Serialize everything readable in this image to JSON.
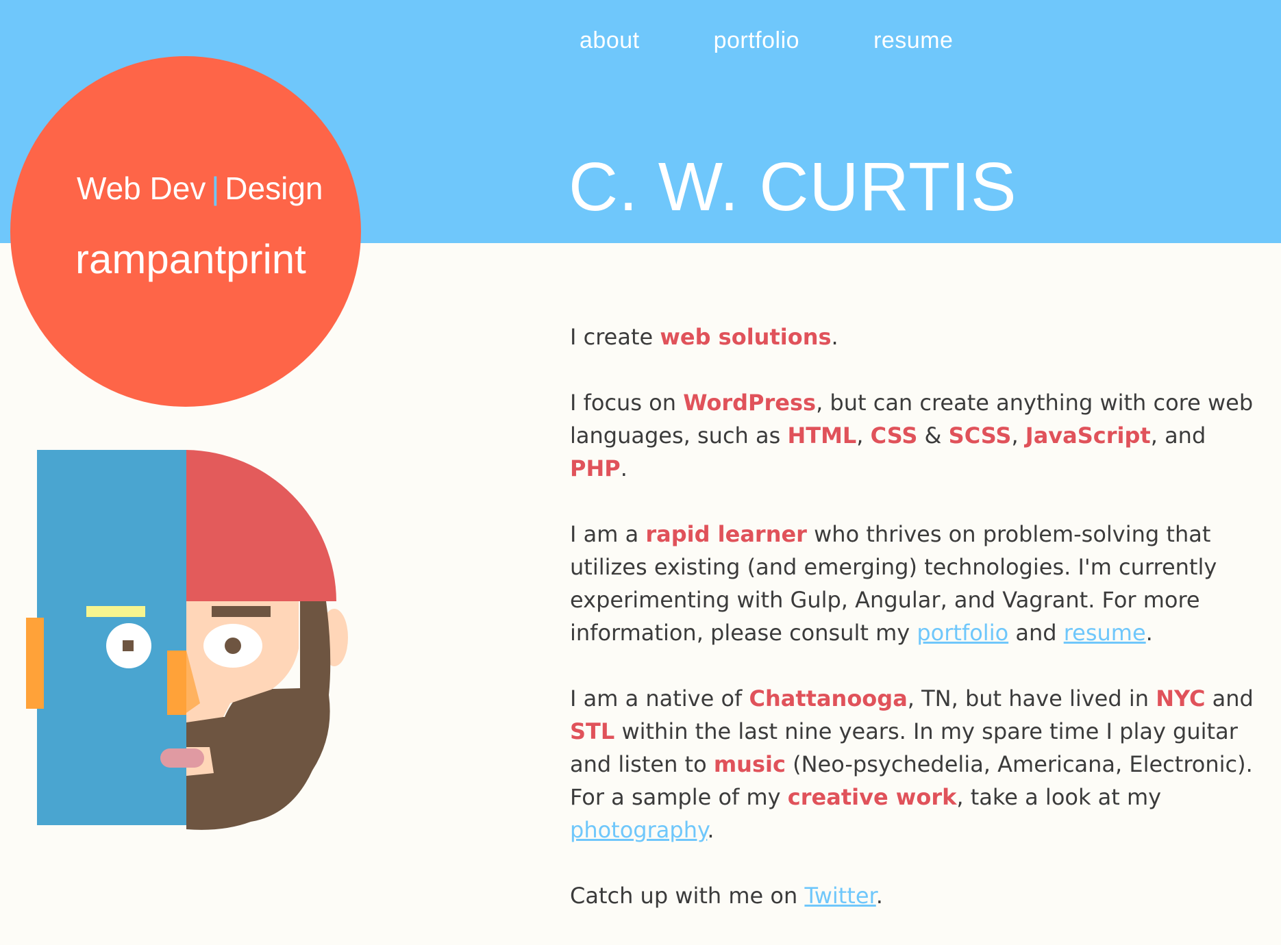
{
  "nav": {
    "items": [
      {
        "label": "about"
      },
      {
        "label": "portfolio"
      },
      {
        "label": "resume"
      }
    ]
  },
  "header": {
    "title": "C. W. CURTIS"
  },
  "badge": {
    "tagline_left": "Web Dev",
    "tagline_separator": "|",
    "tagline_right": "Design",
    "brand": "rampantprint"
  },
  "colors": {
    "header_bg": "#6fc7fb",
    "badge_bg": "#fe6548",
    "highlight": "#e0525a",
    "link": "#6fc7fb",
    "page_bg": "#fdfcf7"
  },
  "content": {
    "p1": {
      "t1": "I create ",
      "h1": "web solutions",
      "t2": "."
    },
    "p2": {
      "t1": "I focus on ",
      "h1": "WordPress",
      "t2": ", but can create anything with core web languages, such as ",
      "h2": "HTML",
      "t3": ", ",
      "h3": "CSS",
      "t4": " & ",
      "h4": "SCSS",
      "t5": ", ",
      "h5": "JavaScript",
      "t6": ", and ",
      "h6": "PHP",
      "t7": "."
    },
    "p3": {
      "t1": "I am a ",
      "h1": "rapid learner",
      "t2": " who thrives on problem-solving that utilizes existing (and emerging) technologies. I'm currently experimenting with Gulp, Angular, and Vagrant. For more information, please consult my ",
      "l1": "portfolio",
      "t3": " and ",
      "l2": "resume",
      "t4": "."
    },
    "p4": {
      "t1": "I am a native of ",
      "h1": "Chattanooga",
      "t2": ", TN, but have lived in ",
      "h2": "NYC",
      "t3": " and ",
      "h3": "STL",
      "t4": " within the last nine years. In my spare time I play guitar and listen to ",
      "h4": "music",
      "t5": " (Neo-psychedelia, Americana, Electronic). For a sample of my ",
      "h5": "creative work",
      "t6": ", take a look at my ",
      "l1": "photography",
      "t7": "."
    },
    "p5": {
      "t1": "Catch up with me on ",
      "l1": "Twitter",
      "t2": "."
    }
  }
}
